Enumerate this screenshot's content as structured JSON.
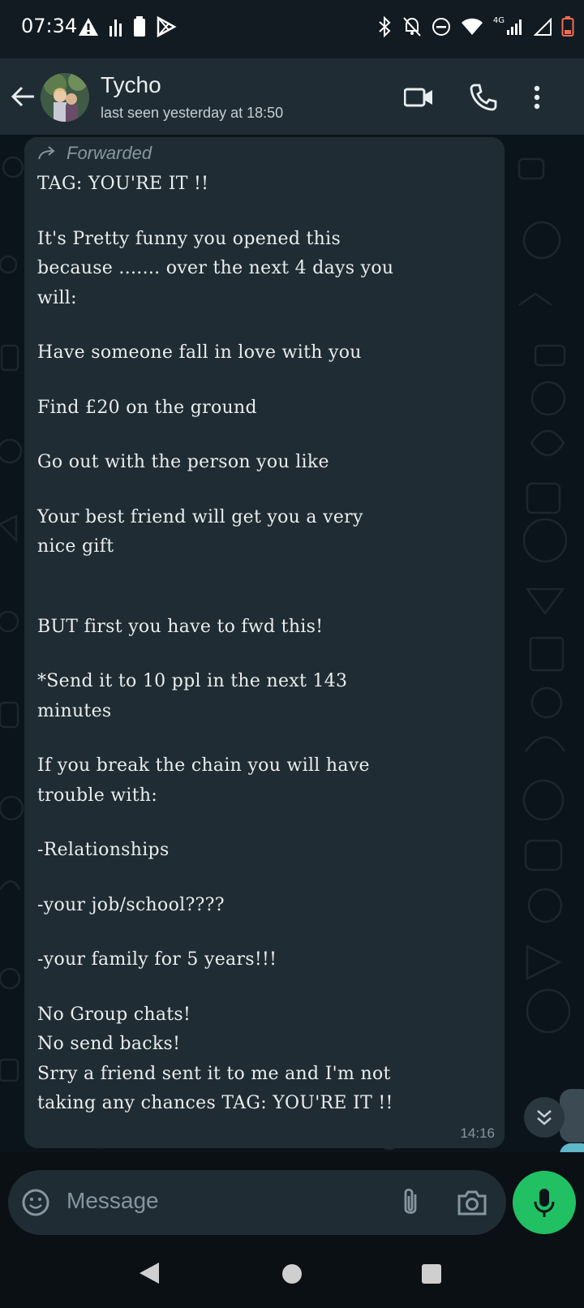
{
  "status_bar": {
    "time": "07:34",
    "network_label": "4G"
  },
  "header": {
    "contact_name": "Tycho",
    "last_seen": "last seen yesterday at 18:50"
  },
  "message": {
    "forwarded_label": "Forwarded",
    "lines": [
      "TAG: YOU'RE IT !!",
      "",
      "It's Pretty funny you opened this",
      "because ....... over the next 4 days you",
      "will:",
      "",
      "Have someone fall in love with you",
      "",
      "Find £20 on the ground",
      "",
      "Go out with the person you like",
      "",
      "Your best friend will get you a very",
      "nice gift",
      "",
      "",
      "BUT first you have to fwd this!",
      "",
      "*Send it to 10 ppl in the next 143",
      "minutes",
      "",
      "If you break the chain you will have",
      "trouble with:",
      "",
      "-Relationships",
      "",
      "-your job/school????",
      "",
      "-your family for 5 years!!!",
      "",
      "No Group chats!",
      "No send backs!",
      "Srry a friend sent it to me and I'm not",
      "taking any chances TAG: YOU'RE IT !!"
    ],
    "time": "14:16"
  },
  "composer": {
    "placeholder": "Message"
  },
  "colors": {
    "accent_green": "#21c063",
    "bubble": "#202c33",
    "header": "#1f2c34",
    "chat_bg": "#0b141a"
  }
}
